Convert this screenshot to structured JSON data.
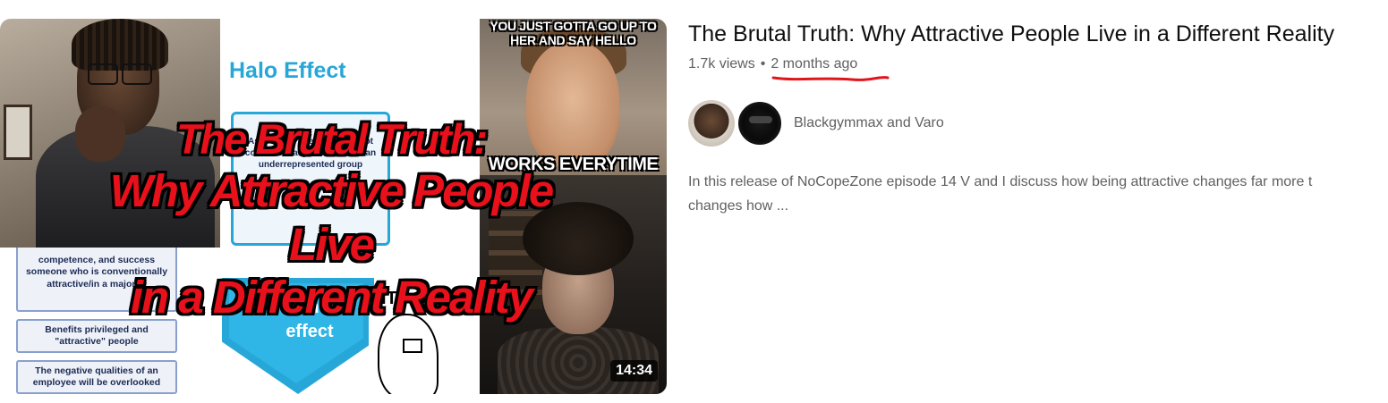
{
  "video": {
    "title": "The Brutal Truth: Why Attractive People Live in a Different Reality",
    "views": "1.7k views",
    "separator": "•",
    "age": "2 months ago",
    "duration": "14:34",
    "channel_name": "Blackgymmax and Varo",
    "description": "In this release of NoCopeZone episode 14 V and I discuss how being attractive changes far more t\nchanges how ..."
  },
  "thumbnail": {
    "overlay_lines": [
      "The Brutal Truth:",
      "Why Attractive People Live",
      "in a Different Reality"
    ],
    "halo_title": "Halo Effect",
    "halo_box_text": "Associates intelligence ... not conventionally attractive, in an underrepresented group",
    "horn_text": "The horn effect",
    "infographic_items": [
      "competence, and success someone who is conventionally attractive/in a majority",
      "Benefits privileged and \"attractive\" people",
      "The negative qualities of an employee will be overlooked"
    ],
    "meme_top": "YOU JUST GOTTA GO UP TO HER AND SAY HELLO",
    "meme_bottom": "WORKS EVERYTIME",
    "wojak_title": "ITS OVER"
  },
  "colors": {
    "annotation": "#e0151b",
    "overlay_text": "#e8101a",
    "halo_blue": "#27a7d8"
  }
}
